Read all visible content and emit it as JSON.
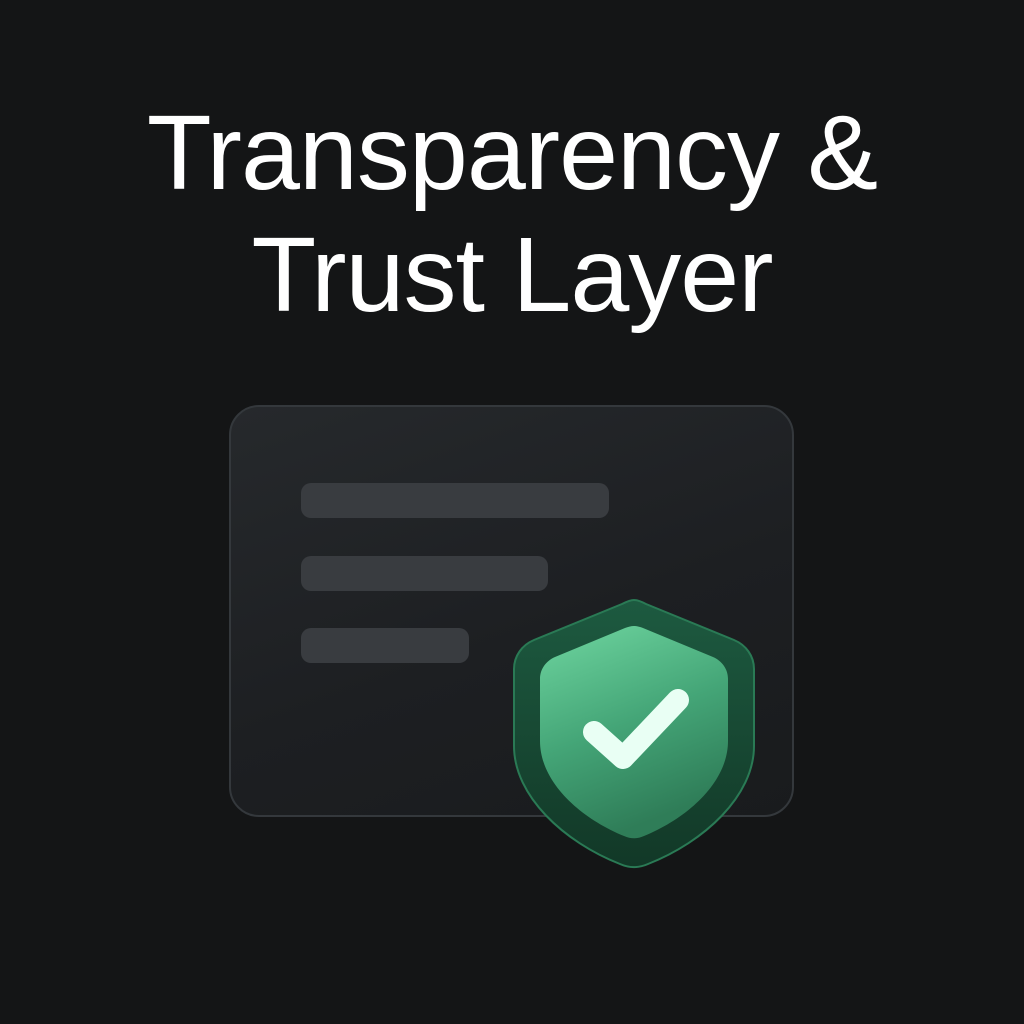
{
  "title": {
    "line1": "Transparency &",
    "line2": "Trust Layer"
  },
  "icons": {
    "card": "document-card-icon",
    "badge": "shield-check-icon"
  },
  "colors": {
    "background": "#141516",
    "title_text": "#ffffff",
    "card_surface": "#222528",
    "text_placeholder": "#393c40",
    "shield_green_light": "#6fd6a0",
    "shield_green_dark": "#2f7d58",
    "check_mark": "#e9fff4"
  }
}
